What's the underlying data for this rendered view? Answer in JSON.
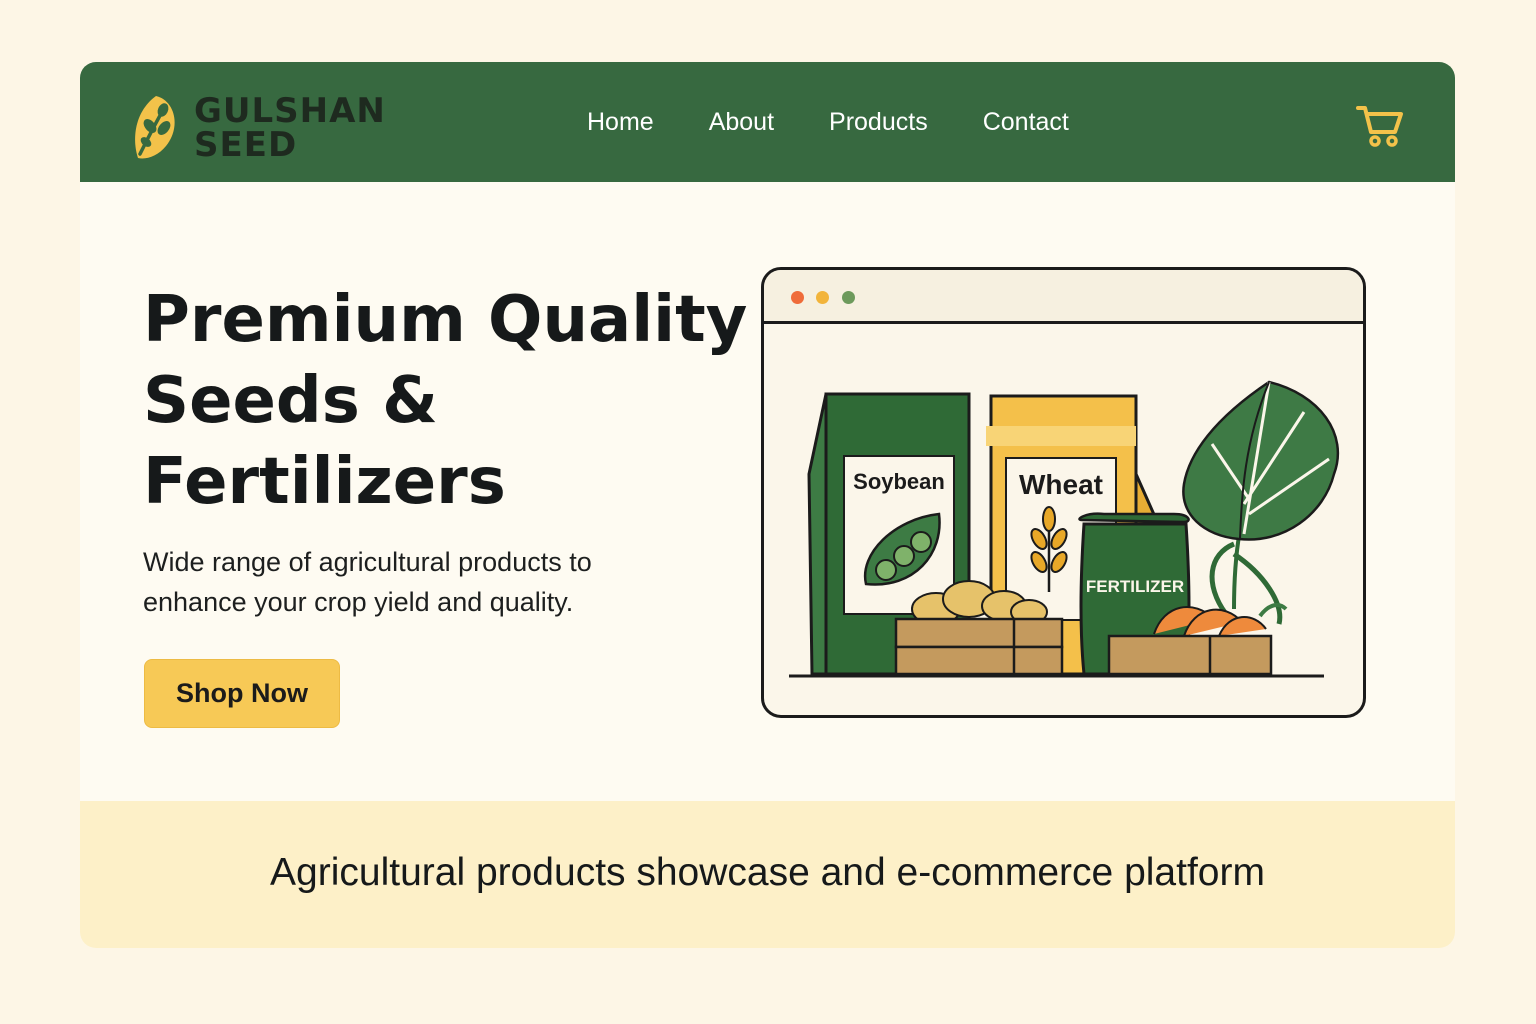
{
  "brand": {
    "name_line1": "GULSHAN",
    "name_line2": "SEED",
    "logo_icon": "leaf-sprout-icon",
    "colors": {
      "primary_green": "#376940",
      "accent_yellow": "#f7c956",
      "background": "#fefbf2"
    }
  },
  "nav": {
    "links": [
      {
        "label": "Home"
      },
      {
        "label": "About"
      },
      {
        "label": "Products"
      },
      {
        "label": "Contact"
      }
    ],
    "cart_icon": "shopping-cart-icon"
  },
  "hero": {
    "title_line1": "Premium Quality",
    "title_line2": "Seeds &",
    "title_line3": "Fertilizers",
    "subtitle": "Wide range of agricultural products to enhance your crop yield and quality.",
    "cta_label": "Shop Now"
  },
  "illustration": {
    "bag1_label": "Soybean",
    "bag2_label": "Wheat",
    "bag3_label": "FERTILIZER",
    "window_dots": [
      "#ef6c3a",
      "#f2b43b",
      "#6d9a5c"
    ]
  },
  "footer": {
    "tagline": "Agricultural products showcase and e-commerce platform"
  }
}
